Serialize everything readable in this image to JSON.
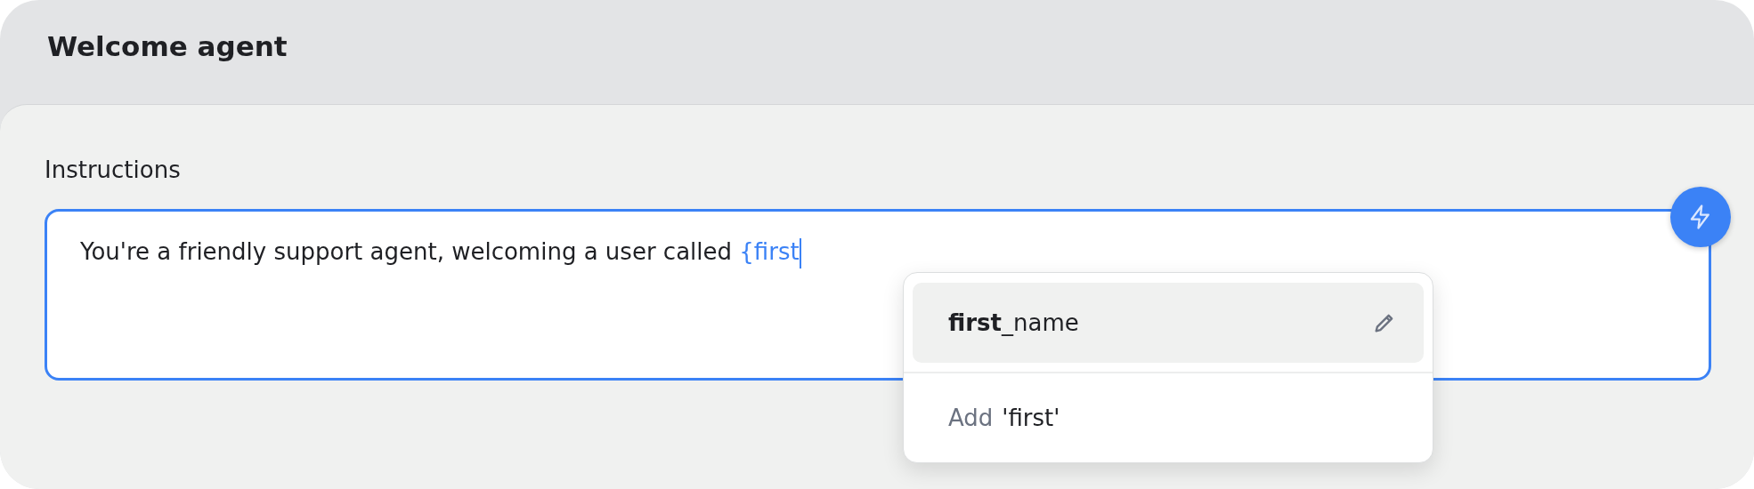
{
  "header": {
    "title": "Welcome agent"
  },
  "instructions": {
    "label": "Instructions",
    "text": "You're a friendly support agent, welcoming a user called ",
    "token": "{first",
    "focused": true
  },
  "suggestions": {
    "items": [
      {
        "label": "**first**_name",
        "selected": true
      }
    ],
    "add_option": {
      "label": "Add",
      "value": "'first'"
    }
  }
}
